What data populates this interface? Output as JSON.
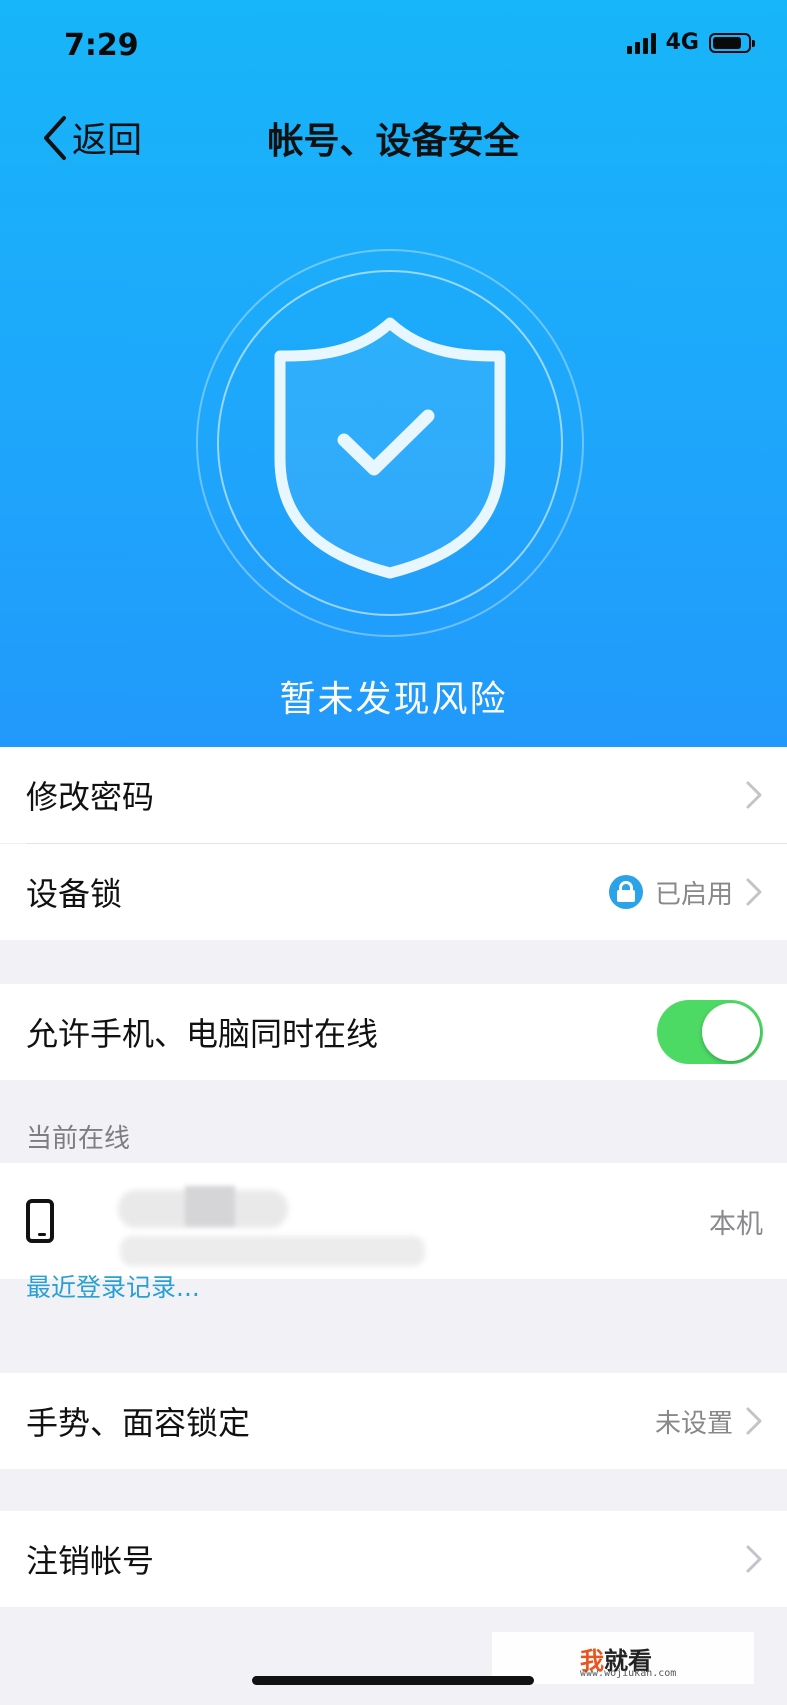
{
  "status_bar": {
    "time": "7:29",
    "network": "4G"
  },
  "nav": {
    "back_label": "返回",
    "title": "帐号、设备安全"
  },
  "hero": {
    "status_text": "暂未发现风险"
  },
  "rows": {
    "change_password": "修改密码",
    "device_lock": {
      "label": "设备锁",
      "value": "已启用"
    },
    "multi_online": {
      "label": "允许手机、电脑同时在线",
      "enabled": true
    },
    "gesture_lock": {
      "label": "手势、面容锁定",
      "value": "未设置"
    },
    "cancel_account": "注销帐号"
  },
  "online": {
    "section_title": "当前在线",
    "device": {
      "tag": "本机"
    },
    "recent_login_link": "最近登录记录..."
  },
  "watermark": {
    "main_accent": "我",
    "main_rest": "就看",
    "sub": "www.wojiukan.com"
  },
  "colors": {
    "hero_top": "#17b5f9",
    "hero_bottom": "#2199fb",
    "toggle_on": "#4cd964",
    "link": "#2a9fd6"
  }
}
